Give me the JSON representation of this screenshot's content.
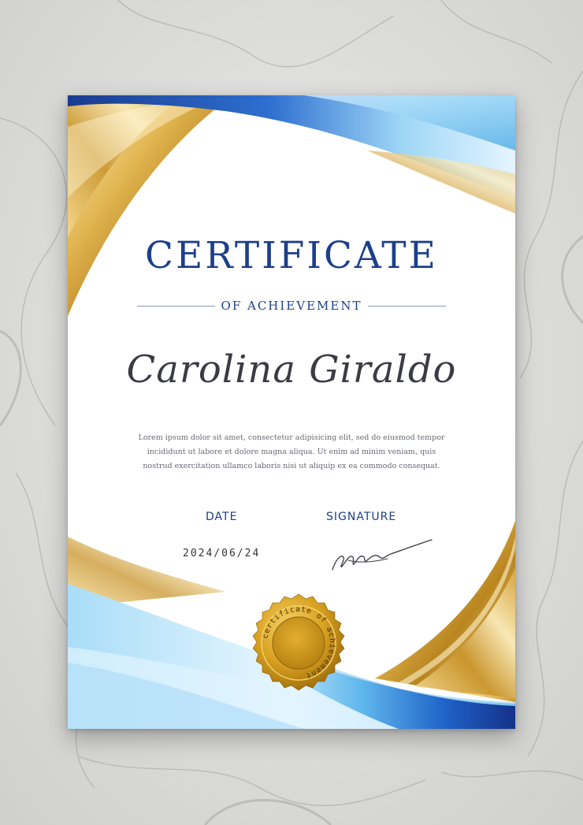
{
  "certificate": {
    "title": "CERTIFICATE",
    "subtitle": "OF ACHIEVEMENT",
    "recipient": "Carolina Giraldo",
    "body": "Lorem ipsum dolor sit amet, consectetur adipisicing elit, sed do eiusmod tempor incididunt ut labore et dolore magna aliqua. Ut enim ad minim veniam, quis nostrud exercitation ullamco laboris nisi ut aliquip ex ea commodo consequat.",
    "date_label": "DATE",
    "date_value": "2024/06/24",
    "signature_label": "SIGNATURE",
    "seal_text": "certificate of achievement"
  },
  "colors": {
    "navy": "#1c3f8a",
    "gold": "#d4a53a",
    "sky_blue": "#7cc4ee",
    "marble": "#d9d9d7"
  }
}
